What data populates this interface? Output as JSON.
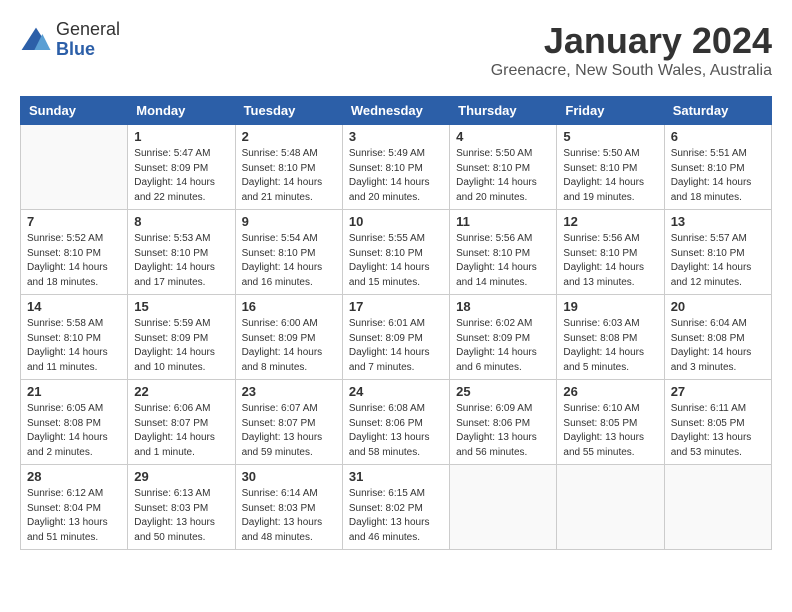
{
  "logo": {
    "general": "General",
    "blue": "Blue"
  },
  "header": {
    "title": "January 2024",
    "location": "Greenacre, New South Wales, Australia"
  },
  "days_of_week": [
    "Sunday",
    "Monday",
    "Tuesday",
    "Wednesday",
    "Thursday",
    "Friday",
    "Saturday"
  ],
  "weeks": [
    [
      {
        "day": "",
        "info": ""
      },
      {
        "day": "1",
        "info": "Sunrise: 5:47 AM\nSunset: 8:09 PM\nDaylight: 14 hours\nand 22 minutes."
      },
      {
        "day": "2",
        "info": "Sunrise: 5:48 AM\nSunset: 8:10 PM\nDaylight: 14 hours\nand 21 minutes."
      },
      {
        "day": "3",
        "info": "Sunrise: 5:49 AM\nSunset: 8:10 PM\nDaylight: 14 hours\nand 20 minutes."
      },
      {
        "day": "4",
        "info": "Sunrise: 5:50 AM\nSunset: 8:10 PM\nDaylight: 14 hours\nand 20 minutes."
      },
      {
        "day": "5",
        "info": "Sunrise: 5:50 AM\nSunset: 8:10 PM\nDaylight: 14 hours\nand 19 minutes."
      },
      {
        "day": "6",
        "info": "Sunrise: 5:51 AM\nSunset: 8:10 PM\nDaylight: 14 hours\nand 18 minutes."
      }
    ],
    [
      {
        "day": "7",
        "info": "Sunrise: 5:52 AM\nSunset: 8:10 PM\nDaylight: 14 hours\nand 18 minutes."
      },
      {
        "day": "8",
        "info": "Sunrise: 5:53 AM\nSunset: 8:10 PM\nDaylight: 14 hours\nand 17 minutes."
      },
      {
        "day": "9",
        "info": "Sunrise: 5:54 AM\nSunset: 8:10 PM\nDaylight: 14 hours\nand 16 minutes."
      },
      {
        "day": "10",
        "info": "Sunrise: 5:55 AM\nSunset: 8:10 PM\nDaylight: 14 hours\nand 15 minutes."
      },
      {
        "day": "11",
        "info": "Sunrise: 5:56 AM\nSunset: 8:10 PM\nDaylight: 14 hours\nand 14 minutes."
      },
      {
        "day": "12",
        "info": "Sunrise: 5:56 AM\nSunset: 8:10 PM\nDaylight: 14 hours\nand 13 minutes."
      },
      {
        "day": "13",
        "info": "Sunrise: 5:57 AM\nSunset: 8:10 PM\nDaylight: 14 hours\nand 12 minutes."
      }
    ],
    [
      {
        "day": "14",
        "info": "Sunrise: 5:58 AM\nSunset: 8:10 PM\nDaylight: 14 hours\nand 11 minutes."
      },
      {
        "day": "15",
        "info": "Sunrise: 5:59 AM\nSunset: 8:09 PM\nDaylight: 14 hours\nand 10 minutes."
      },
      {
        "day": "16",
        "info": "Sunrise: 6:00 AM\nSunset: 8:09 PM\nDaylight: 14 hours\nand 8 minutes."
      },
      {
        "day": "17",
        "info": "Sunrise: 6:01 AM\nSunset: 8:09 PM\nDaylight: 14 hours\nand 7 minutes."
      },
      {
        "day": "18",
        "info": "Sunrise: 6:02 AM\nSunset: 8:09 PM\nDaylight: 14 hours\nand 6 minutes."
      },
      {
        "day": "19",
        "info": "Sunrise: 6:03 AM\nSunset: 8:08 PM\nDaylight: 14 hours\nand 5 minutes."
      },
      {
        "day": "20",
        "info": "Sunrise: 6:04 AM\nSunset: 8:08 PM\nDaylight: 14 hours\nand 3 minutes."
      }
    ],
    [
      {
        "day": "21",
        "info": "Sunrise: 6:05 AM\nSunset: 8:08 PM\nDaylight: 14 hours\nand 2 minutes."
      },
      {
        "day": "22",
        "info": "Sunrise: 6:06 AM\nSunset: 8:07 PM\nDaylight: 14 hours\nand 1 minute."
      },
      {
        "day": "23",
        "info": "Sunrise: 6:07 AM\nSunset: 8:07 PM\nDaylight: 13 hours\nand 59 minutes."
      },
      {
        "day": "24",
        "info": "Sunrise: 6:08 AM\nSunset: 8:06 PM\nDaylight: 13 hours\nand 58 minutes."
      },
      {
        "day": "25",
        "info": "Sunrise: 6:09 AM\nSunset: 8:06 PM\nDaylight: 13 hours\nand 56 minutes."
      },
      {
        "day": "26",
        "info": "Sunrise: 6:10 AM\nSunset: 8:05 PM\nDaylight: 13 hours\nand 55 minutes."
      },
      {
        "day": "27",
        "info": "Sunrise: 6:11 AM\nSunset: 8:05 PM\nDaylight: 13 hours\nand 53 minutes."
      }
    ],
    [
      {
        "day": "28",
        "info": "Sunrise: 6:12 AM\nSunset: 8:04 PM\nDaylight: 13 hours\nand 51 minutes."
      },
      {
        "day": "29",
        "info": "Sunrise: 6:13 AM\nSunset: 8:03 PM\nDaylight: 13 hours\nand 50 minutes."
      },
      {
        "day": "30",
        "info": "Sunrise: 6:14 AM\nSunset: 8:03 PM\nDaylight: 13 hours\nand 48 minutes."
      },
      {
        "day": "31",
        "info": "Sunrise: 6:15 AM\nSunset: 8:02 PM\nDaylight: 13 hours\nand 46 minutes."
      },
      {
        "day": "",
        "info": ""
      },
      {
        "day": "",
        "info": ""
      },
      {
        "day": "",
        "info": ""
      }
    ]
  ]
}
